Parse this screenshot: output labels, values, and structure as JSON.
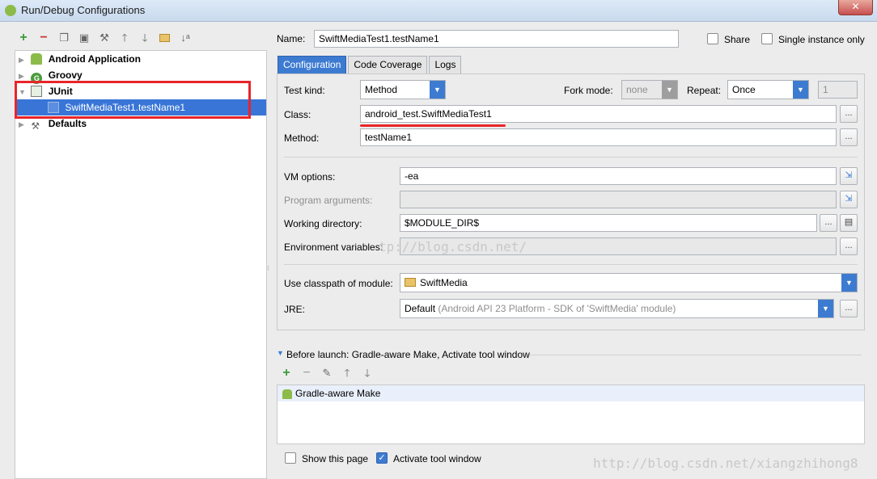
{
  "window": {
    "title": "Run/Debug Configurations",
    "close_glyph": "✕"
  },
  "toolbar": {
    "icons": [
      "add-icon",
      "remove-icon",
      "copy-icon",
      "save-icon",
      "wrench-icon",
      "move-up-icon",
      "move-down-icon",
      "folder-icon",
      "sort-icon"
    ]
  },
  "tree": {
    "items": [
      {
        "label": "Android Application",
        "icon": "android-icon"
      },
      {
        "label": "Groovy",
        "icon": "groovy-icon",
        "icon_glyph": "G"
      },
      {
        "label": "JUnit",
        "icon": "junit-icon"
      },
      {
        "label": "SwiftMediaTest1.testName1",
        "icon": "test-icon"
      },
      {
        "label": "Defaults",
        "icon": "wrench-icon"
      }
    ]
  },
  "header": {
    "name_label": "Name:",
    "name_value": "SwiftMediaTest1.testName1",
    "share_label": "Share",
    "single_instance_label": "Single instance only"
  },
  "tabs": [
    {
      "label": "Configuration"
    },
    {
      "label": "Code Coverage"
    },
    {
      "label": "Logs"
    }
  ],
  "config": {
    "test_kind_label": "Test kind:",
    "test_kind_value": "Method",
    "fork_mode_label": "Fork mode:",
    "fork_mode_value": "none",
    "repeat_label": "Repeat:",
    "repeat_value": "Once",
    "repeat_count": "1",
    "class_label": "Class:",
    "class_value": "android_test.SwiftMediaTest1",
    "method_label": "Method:",
    "method_value": "testName1",
    "vm_options_label": "VM options:",
    "vm_options_value": "-ea",
    "program_args_label": "Program arguments:",
    "program_args_value": "",
    "working_dir_label": "Working directory:",
    "working_dir_value": "$MODULE_DIR$",
    "env_vars_label": "Environment variables:",
    "env_vars_value": "",
    "classpath_label": "Use classpath of module:",
    "classpath_value": "SwiftMedia",
    "jre_label": "JRE:",
    "jre_default": "Default",
    "jre_detail": "(Android API 23 Platform - SDK of 'SwiftMedia' module)",
    "dots": "..."
  },
  "before_launch": {
    "title": "Before launch: Gradle-aware Make, Activate tool window",
    "items": [
      "Gradle-aware Make"
    ]
  },
  "footer": {
    "show_page_label": "Show this page",
    "activate_tool_label": "Activate tool window"
  },
  "watermarks": {
    "center": "tp://blog.csdn.net/",
    "bottom": "http://blog.csdn.net/xiangzhihong8"
  },
  "colors": {
    "accent": "#3d7bd1",
    "annotation_red": "#e8252a",
    "android_green": "#8dbb49"
  }
}
